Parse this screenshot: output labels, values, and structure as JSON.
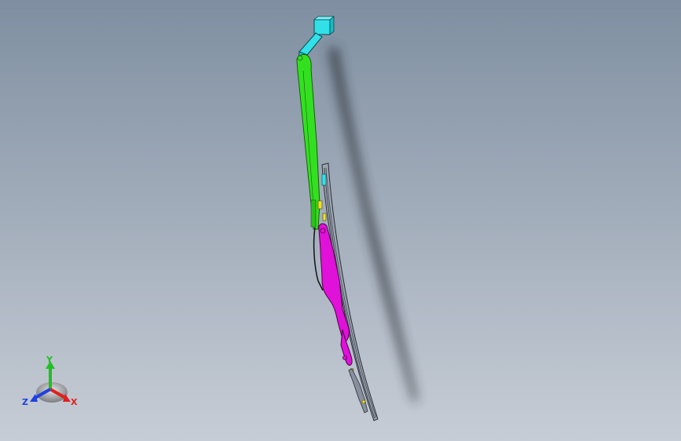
{
  "viewport": {
    "background_top": "#7f8fa1",
    "background_bottom": "#c7cdd6"
  },
  "model": {
    "parts": [
      {
        "name": "mount-block",
        "color": "#32e0e8"
      },
      {
        "name": "wiper-arm",
        "color": "#33e020"
      },
      {
        "name": "wiper-blade-frame",
        "color": "#e011d8"
      },
      {
        "name": "blade-rubber",
        "color": "#7a8290"
      },
      {
        "name": "blade-detail",
        "color": "#f0e020"
      }
    ]
  },
  "triad": {
    "x_label": "X",
    "y_label": "Y",
    "z_label": "Z",
    "x_color": "#e02020",
    "y_color": "#20c020",
    "z_color": "#2040e0"
  }
}
